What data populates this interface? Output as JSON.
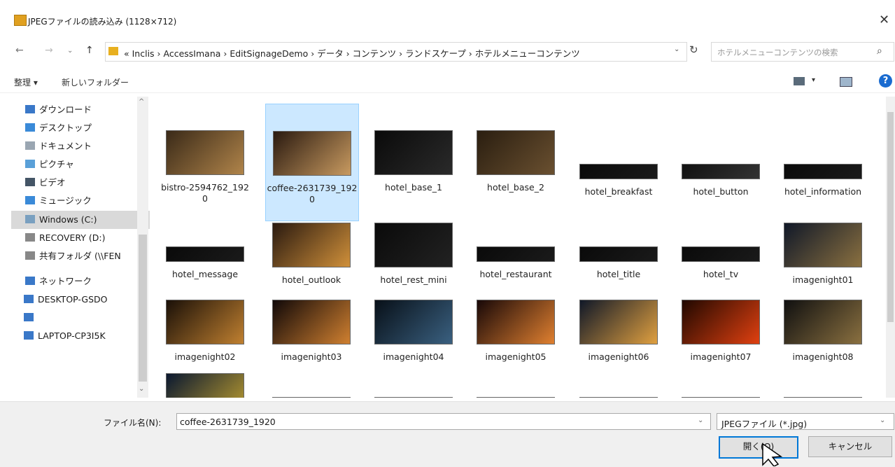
{
  "window": {
    "title": "JPEGファイルの読み込み (1128×712)"
  },
  "address": {
    "path": "«  Inclis  ›  AccessImana  ›  EditSignageDemo  ›  データ  ›  コンテンツ  ›  ランドスケープ  ›  ホテルメニューコンテンツ",
    "search_placeholder": "ホテルメニューコンテンツの検索"
  },
  "toolbar": {
    "organize": "整理 ▾",
    "new_folder": "新しいフォルダー"
  },
  "nav": {
    "items": [
      {
        "label": "ダウンロード",
        "color": "#3a78c8"
      },
      {
        "label": "デスクトップ",
        "color": "#3a8ad8"
      },
      {
        "label": "ドキュメント",
        "color": "#9aa6b2"
      },
      {
        "label": "ピクチャ",
        "color": "#5aa0d8"
      },
      {
        "label": "ビデオ",
        "color": "#445566"
      },
      {
        "label": "ミュージック",
        "color": "#3a8ad8"
      },
      {
        "label": "Windows (C:)",
        "color": "#7aa0c0"
      },
      {
        "label": "RECOVERY (D:)",
        "color": "#888888"
      },
      {
        "label": "共有フォルダ (\\\\FEN",
        "color": "#888888"
      },
      {
        "label": "ネットワーク",
        "color": "#3a78c8"
      },
      {
        "label": "DESKTOP-GSDO",
        "color": "#3a78c8"
      },
      {
        "label": " ",
        "color": "#3a78c8"
      },
      {
        "label": "LAPTOP-CP3I5K",
        "color": "#3a78c8"
      }
    ]
  },
  "files": [
    {
      "name": "bistro-2594762_1920",
      "c": [
        "#3a2a18",
        "#b0844a"
      ]
    },
    {
      "name": "coffee-2631739_1920",
      "c": [
        "#2a1a10",
        "#c89a60"
      ]
    },
    {
      "name": "hotel_base_1",
      "c": [
        "#0a0a0a",
        "#2a2a2a"
      ]
    },
    {
      "name": "hotel_base_2",
      "c": [
        "#2a1e10",
        "#6a5030"
      ]
    },
    {
      "name": "hotel_breakfast",
      "c": [
        "#0a0a0a",
        "#1a1a1a"
      ]
    },
    {
      "name": "hotel_button",
      "c": [
        "#111111",
        "#333333"
      ]
    },
    {
      "name": "hotel_information",
      "c": [
        "#0a0a0a",
        "#1a1a1a"
      ]
    },
    {
      "name": "hotel_message",
      "c": [
        "#0a0a0a",
        "#1a1a1a"
      ]
    },
    {
      "name": "hotel_outlook",
      "c": [
        "#2a1a10",
        "#d0903a"
      ]
    },
    {
      "name": "hotel_rest_mini",
      "c": [
        "#0a0a0a",
        "#222222"
      ]
    },
    {
      "name": "hotel_restaurant",
      "c": [
        "#0a0a0a",
        "#1a1a1a"
      ]
    },
    {
      "name": "hotel_title",
      "c": [
        "#0a0a0a",
        "#1a1a1a"
      ]
    },
    {
      "name": "hotel_tv",
      "c": [
        "#0a0a0a",
        "#1a1a1a"
      ]
    },
    {
      "name": "imagenight01",
      "c": [
        "#101828",
        "#8a7040"
      ]
    },
    {
      "name": "imagenight02",
      "c": [
        "#1a1008",
        "#c08030"
      ]
    },
    {
      "name": "imagenight03",
      "c": [
        "#100808",
        "#d08030"
      ]
    },
    {
      "name": "imagenight04",
      "c": [
        "#081018",
        "#3a6080"
      ]
    },
    {
      "name": "imagenight05",
      "c": [
        "#180808",
        "#e08030"
      ]
    },
    {
      "name": "imagenight06",
      "c": [
        "#101828",
        "#e0a040"
      ]
    },
    {
      "name": "imagenight07",
      "c": [
        "#200800",
        "#e04010"
      ]
    },
    {
      "name": "imagenight08",
      "c": [
        "#101010",
        "#8a7040"
      ]
    },
    {
      "name": "",
      "c": [
        "#0a1830",
        "#c0a030"
      ]
    },
    {
      "name": "",
      "c": [
        "#050505",
        "#111111"
      ]
    },
    {
      "name": "",
      "c": [
        "#050505",
        "#111111"
      ]
    },
    {
      "name": "",
      "c": [
        "#050505",
        "#111111"
      ]
    },
    {
      "name": "",
      "c": [
        "#050505",
        "#111111"
      ]
    },
    {
      "name": "",
      "c": [
        "#050505",
        "#111111"
      ]
    },
    {
      "name": "",
      "c": [
        "#050505",
        "#111111"
      ]
    }
  ],
  "filename": {
    "label": "ファイル名(N):",
    "value": "coffee-2631739_1920"
  },
  "filetype": {
    "value": "JPEGファイル (*.jpg)"
  },
  "buttons": {
    "open": "開く(O)",
    "cancel": "キャンセル"
  },
  "colors": {
    "selection": "#cce8ff",
    "accent": "#0078d7"
  }
}
